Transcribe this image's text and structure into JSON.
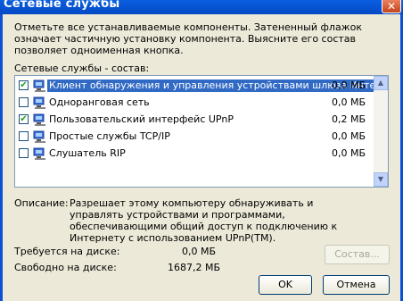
{
  "window": {
    "title": "Сетевые службы",
    "close_glyph": "✕"
  },
  "description": "Отметьте все устанавливаемые компоненты. Затененный флажок означает частичную установку компонента. Выясните его состав позволяет одноименная кнопка.",
  "components_label": "Сетевые службы - состав:",
  "components": [
    {
      "name": "Клиент обнаружения и управления устройствами шлюза Интернета",
      "size": "0,0 МБ",
      "checked": true,
      "selected": true
    },
    {
      "name": "Одноранговая сеть",
      "size": "0,0 МБ",
      "checked": false,
      "selected": false
    },
    {
      "name": "Пользовательский интерфейс UPnP",
      "size": "0,2 МБ",
      "checked": true,
      "selected": false
    },
    {
      "name": "Простые службы TCP/IP",
      "size": "0,0 МБ",
      "checked": false,
      "selected": false
    },
    {
      "name": "Слушатель RIP",
      "size": "0,0 МБ",
      "checked": false,
      "selected": false
    }
  ],
  "details": {
    "label": "Описание:",
    "text": "Разрешает этому компьютеру обнаруживать и управлять устройствами и программами, обеспечивающими общий доступ к подключению к Интернету с использованием UPnP(TM)."
  },
  "disk": {
    "required_label": "Требуется на диске:",
    "required_value": "0,0 МБ",
    "free_label": "Свободно на диске:",
    "free_value": "1687,2 МБ"
  },
  "buttons": {
    "compose": "Состав...",
    "ok": "OK",
    "cancel": "Отмена"
  },
  "icons": {
    "component": "network-service-icon"
  },
  "colors": {
    "titlebar": "#0a5fe0",
    "selection": "#316ac5",
    "dialog_bg": "#ece9d8"
  }
}
